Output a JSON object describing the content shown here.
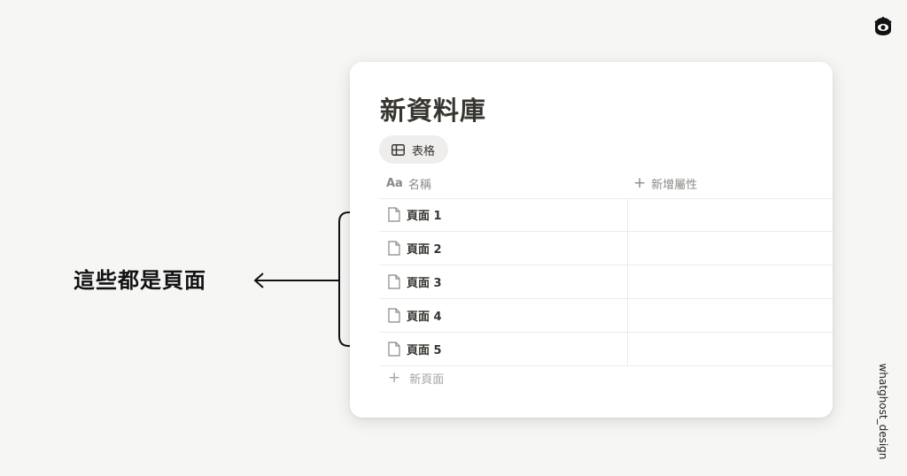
{
  "database": {
    "title": "新資料庫",
    "view_tab": "表格",
    "columns": {
      "name_icon": "Aa",
      "name": "名稱",
      "add_property": "新增屬性"
    },
    "rows": [
      {
        "name": "頁面 1"
      },
      {
        "name": "頁面 2"
      },
      {
        "name": "頁面 3"
      },
      {
        "name": "頁面 4"
      },
      {
        "name": "頁面 5"
      }
    ],
    "new_page": "新頁面"
  },
  "annotation": {
    "text": "這些都是頁面"
  },
  "brand": {
    "handle": "whatghost_design"
  },
  "icons": {
    "logo": "ghost-eye-logo-icon",
    "view": "table-icon",
    "page": "page-icon",
    "add": "plus-icon",
    "arrow": "arrow-left-icon"
  },
  "colors": {
    "background": "#f6f6f5",
    "card": "#ffffff",
    "text": "#37352f",
    "muted": "#8a8985"
  }
}
